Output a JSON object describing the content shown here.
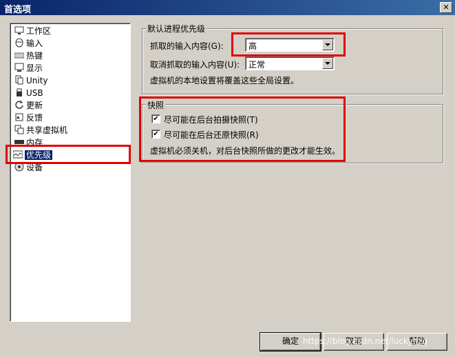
{
  "window": {
    "title": "首选项",
    "close_glyph": "✕"
  },
  "sidebar": {
    "items": [
      {
        "label": "工作区",
        "icon": "monitor-icon"
      },
      {
        "label": "输入",
        "icon": "mouse-icon"
      },
      {
        "label": "热键",
        "icon": "keyboard-icon"
      },
      {
        "label": "显示",
        "icon": "display-icon"
      },
      {
        "label": "Unity",
        "icon": "unity-icon"
      },
      {
        "label": "USB",
        "icon": "usb-icon"
      },
      {
        "label": "更新",
        "icon": "refresh-icon"
      },
      {
        "label": "反馈",
        "icon": "feedback-icon"
      },
      {
        "label": "共享虚拟机",
        "icon": "shared-vm-icon"
      },
      {
        "label": "内存",
        "icon": "memory-icon"
      },
      {
        "label": "优先级",
        "icon": "priority-icon",
        "selected": true
      },
      {
        "label": "设备",
        "icon": "device-icon"
      }
    ]
  },
  "priority_group": {
    "title": "默认进程优先级",
    "grab_label": "抓取的输入内容(G):",
    "grab_value": "高",
    "ungrab_label": "取消抓取的输入内容(U):",
    "ungrab_value": "正常",
    "note": "虚拟机的本地设置将覆盖这些全局设置。"
  },
  "snapshot_group": {
    "title": "快照",
    "option1": "尽可能在后台拍摄快照(T)",
    "option2": "尽可能在后台还原快照(R)",
    "note": "虚拟机必须关机，对后台快照所做的更改才能生效。"
  },
  "buttons": {
    "ok": "确定",
    "cancel": "取消",
    "help": "帮助"
  },
  "watermark": "https://blog.csdn.net/luckyhzg",
  "colors": {
    "highlight_red": "#e00000",
    "selection_blue": "#0a246a"
  }
}
